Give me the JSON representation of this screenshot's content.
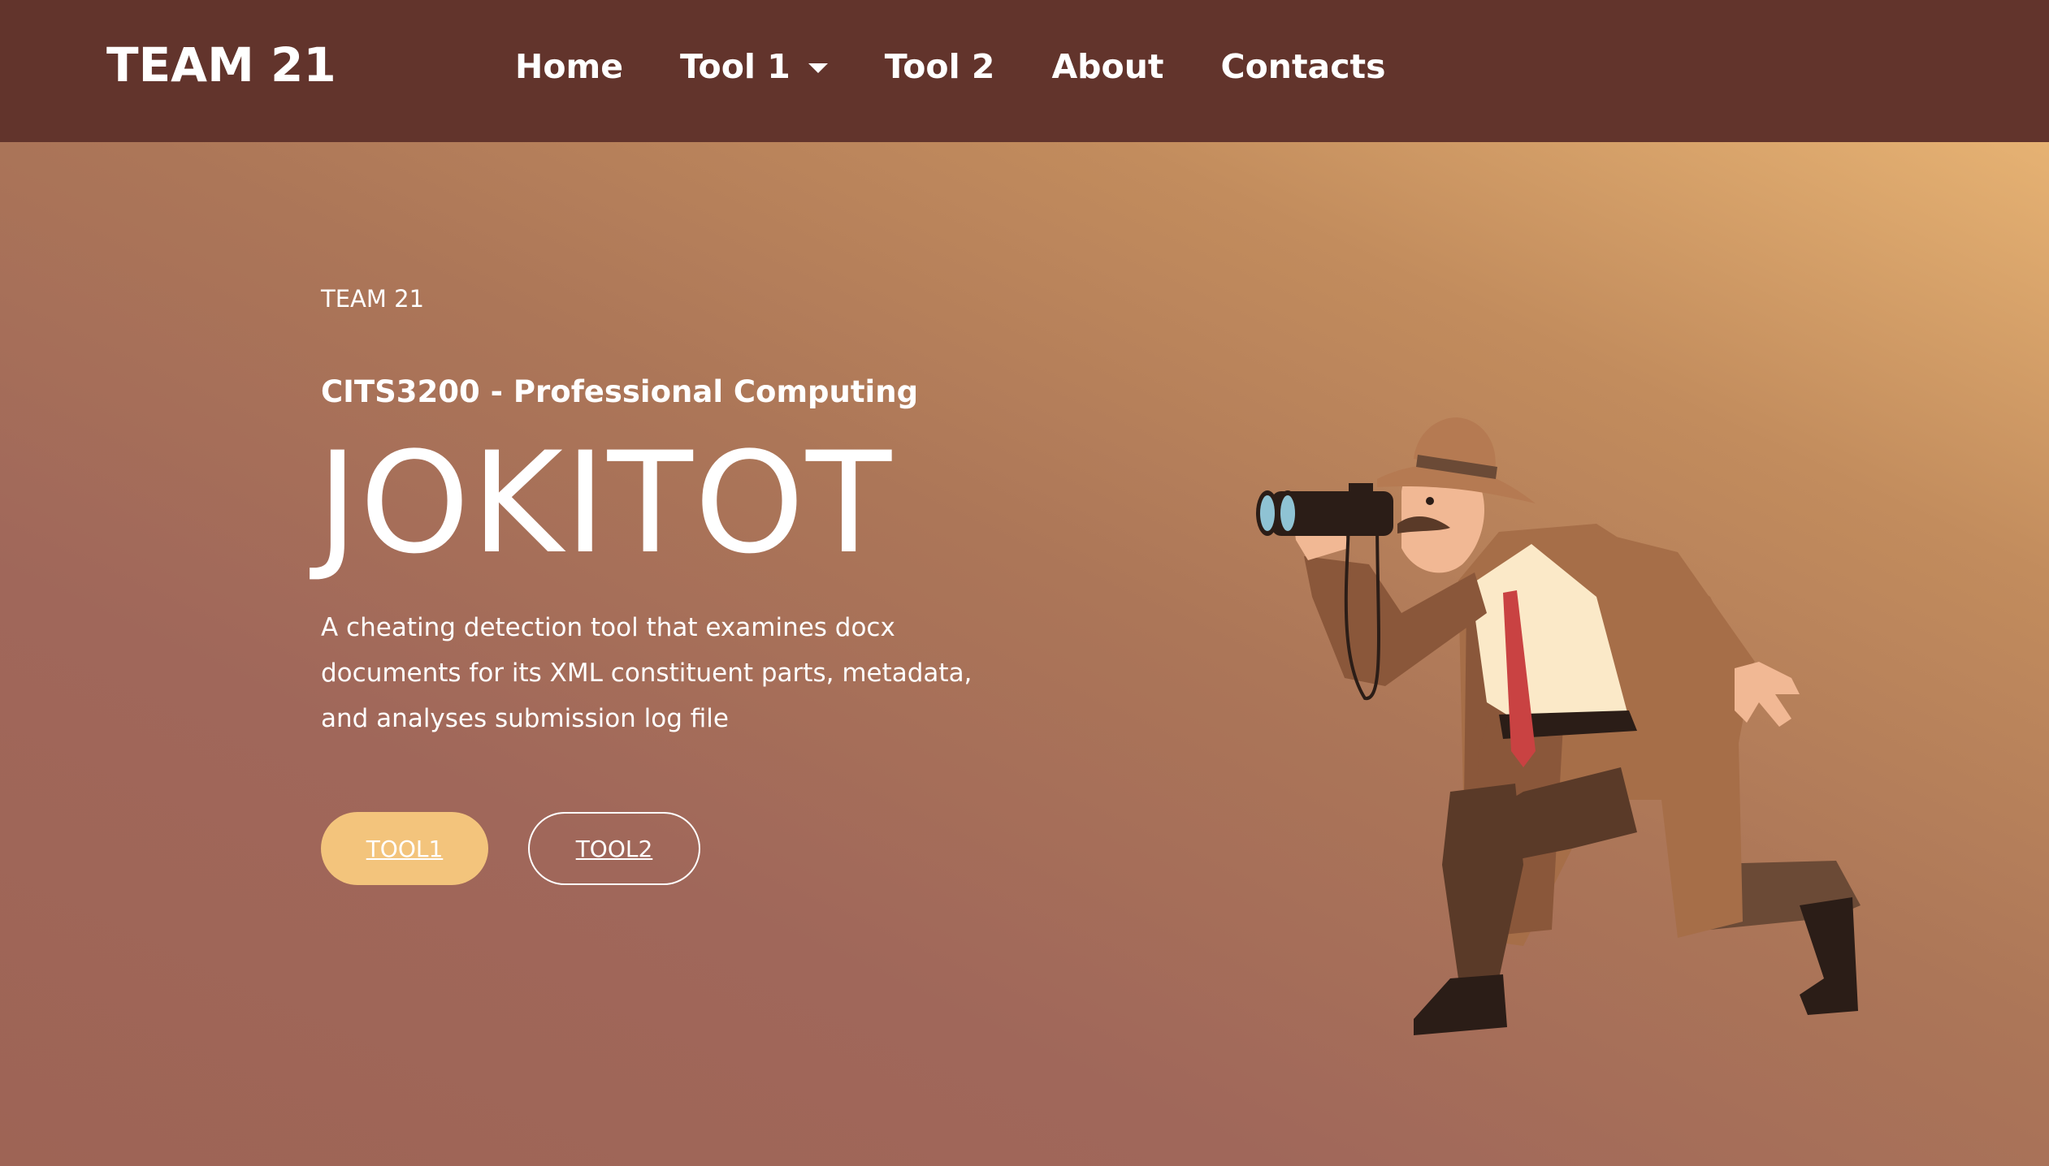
{
  "brand": {
    "name": "TEAM 21"
  },
  "nav": {
    "items": [
      {
        "label": "Home"
      },
      {
        "label": "Tool 1",
        "has_dropdown": true
      },
      {
        "label": "Tool 2"
      },
      {
        "label": "About"
      },
      {
        "label": "Contacts"
      }
    ]
  },
  "hero": {
    "eyebrow": "TEAM 21",
    "subtitle": "CITS3200 - Professional Computing",
    "title": "JOKITOT",
    "description": "A cheating detection tool that examines docx documents for its XML constituent parts, metadata, and analyses submission log file",
    "buttons": {
      "primary": "TOOL1",
      "secondary": "TOOL2"
    },
    "illustration_icon": "detective-with-binoculars-icon"
  },
  "colors": {
    "navbar": "#62342c",
    "primary_button": "#f3c47c",
    "hero_gradient_start": "#e6b273",
    "hero_gradient_end": "#a0675a"
  }
}
